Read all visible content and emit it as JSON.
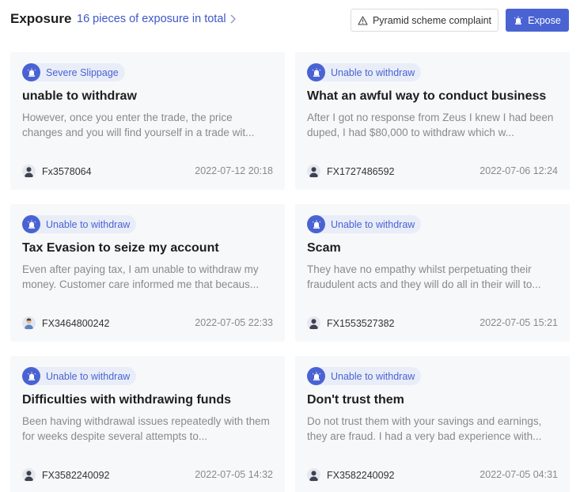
{
  "header": {
    "title": "Exposure",
    "total_link": "16 pieces of exposure in total",
    "complaint_button": "Pyramid scheme complaint",
    "expose_button": "Expose"
  },
  "cards": [
    {
      "badge": "Severe Slippage",
      "title": "unable to withdraw",
      "body": "However, once you enter the trade, the price changes and you will find yourself in a trade wit...",
      "user": "Fx3578064",
      "date": "2022-07-12 20:18"
    },
    {
      "badge": "Unable to withdraw",
      "title": "What an awful way to conduct business",
      "body": "After I got no response from Zeus I knew I had been duped, I had $80,000 to withdraw which w...",
      "user": "FX1727486592",
      "date": "2022-07-06 12:24"
    },
    {
      "badge": "Unable to withdraw",
      "title": "Tax Evasion to seize my account",
      "body": "Even after paying tax, I am unable to withdraw my money. Customer care informed me that becaus...",
      "user": "FX3464800242",
      "date": "2022-07-05 22:33"
    },
    {
      "badge": "Unable to withdraw",
      "title": "Scam",
      "body": "They have no empathy whilst perpetuating their fraudulent acts and they will do all in their will to...",
      "user": "FX1553527382",
      "date": "2022-07-05 15:21"
    },
    {
      "badge": "Unable to withdraw",
      "title": "Difficulties with withdrawing funds",
      "body": "Been having withdrawal issues repeatedly with them for weeks despite several attempts to...",
      "user": "FX3582240092",
      "date": "2022-07-05 14:32"
    },
    {
      "badge": "Unable to withdraw",
      "title": "Don't trust them",
      "body": "Do not trust them with your savings and earnings, they are fraud. I had a very bad experience with...",
      "user": "FX3582240092",
      "date": "2022-07-05 04:31"
    }
  ],
  "colors": {
    "accent": "#4a63d3",
    "badge_bg": "#e9edf8",
    "card_bg": "#f7f8fa"
  },
  "icons": {
    "badge": "alarm-siren-icon",
    "warning": "warning-triangle-icon",
    "avatar": "user-avatar-icon",
    "chevron": "chevron-right-icon"
  }
}
